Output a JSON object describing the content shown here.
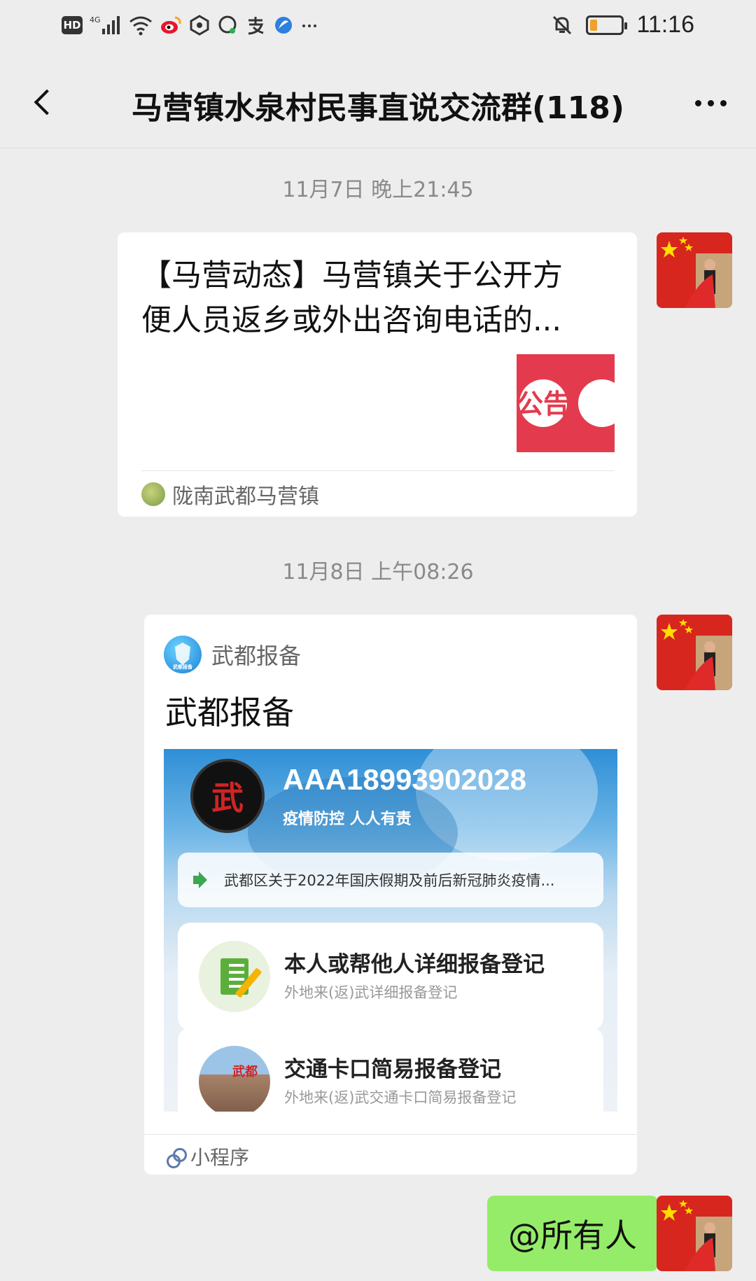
{
  "status_bar": {
    "hd": "HD",
    "network": "4G",
    "time": "11:16"
  },
  "chat": {
    "title": "马营镇水泉村民事直说交流群(118)"
  },
  "messages": [
    {
      "timestamp": "11月7日 晚上21:45",
      "type": "article",
      "title": "【马营动态】马营镇关于公开方便人员返乡或外出咨询电话的...",
      "thumbnail_text": "公告",
      "source": "陇南武都马营镇"
    },
    {
      "timestamp": "11月8日 上午08:26",
      "type": "mini_program",
      "app_name": "武都报备",
      "title": "武都报备",
      "logo_text": "武都报备",
      "preview": {
        "emblem_text": "武",
        "number": "AAA18993902028",
        "slogan": "疫情防控 人人有责",
        "notice": "武都区关于2022年国庆假期及前后新冠肺炎疫情...",
        "items": [
          {
            "title": "本人或帮他人详细报备登记",
            "subtitle": "外地来(返)武详细报备登记"
          },
          {
            "title": "交通卡口简易报备登记",
            "subtitle": "外地来(返)武交通卡口简易报备登记",
            "photo_text": "武都"
          }
        ]
      },
      "footer_label": "小程序"
    },
    {
      "type": "text",
      "text": "@所有人"
    }
  ],
  "colors": {
    "background": "#ededed",
    "bubble_green": "#95ec69",
    "announcement_red": "#e33b4d"
  }
}
